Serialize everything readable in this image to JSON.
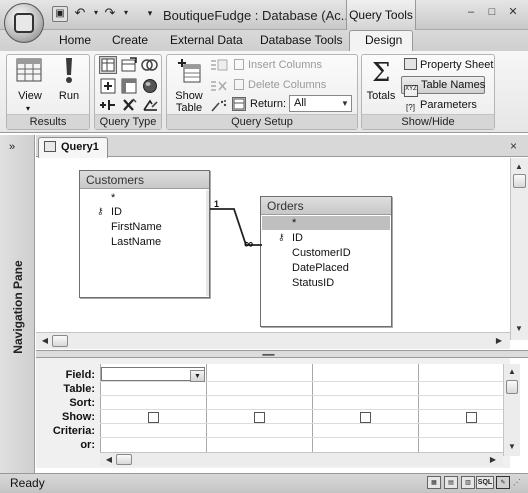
{
  "window": {
    "title": "BoutiqueFudge : Database (Ac...",
    "context_tab": "Query Tools",
    "controls": [
      "minimize",
      "maximize",
      "close"
    ]
  },
  "quick_access": {
    "icons": [
      "save-icon",
      "undo-icon",
      "redo-icon",
      "customize-icon"
    ]
  },
  "ribbon": {
    "tabs": [
      "Home",
      "Create",
      "External Data",
      "Database Tools",
      "Design"
    ],
    "active_tab": "Design",
    "groups": {
      "results": {
        "label": "Results",
        "view": "View",
        "run": "Run"
      },
      "query_type": {
        "label": "Query Type"
      },
      "query_setup": {
        "label": "Query Setup",
        "show_table_line1": "Show",
        "show_table_line2": "Table",
        "insert_columns": "Insert Columns",
        "delete_columns": "Delete Columns",
        "return_label": "Return:",
        "return_value": "All"
      },
      "show_hide": {
        "label": "Show/Hide",
        "totals": "Totals",
        "property_sheet": "Property Sheet",
        "table_names": "Table Names",
        "parameters": "Parameters"
      }
    }
  },
  "navigation_pane": {
    "label": "Navigation Pane",
    "toggle": "»"
  },
  "document": {
    "tab_label": "Query1",
    "close": "×"
  },
  "tables": {
    "customers": {
      "title": "Customers",
      "fields": [
        "*",
        "ID",
        "FirstName",
        "LastName"
      ],
      "key_field": "ID"
    },
    "orders": {
      "title": "Orders",
      "fields": [
        "*",
        "ID",
        "CustomerID",
        "DatePlaced",
        "StatusID"
      ],
      "key_field": "ID",
      "selected_field": "*"
    },
    "relationship": {
      "one_side": "1",
      "many_side": "∞"
    }
  },
  "design_grid": {
    "row_labels": [
      "Field:",
      "Table:",
      "Sort:",
      "Show:",
      "Criteria:",
      "or:"
    ],
    "columns": [
      {
        "field": "",
        "table": "",
        "sort": "",
        "show": false,
        "criteria": "",
        "or": ""
      },
      {
        "field": "",
        "table": "",
        "sort": "",
        "show": false,
        "criteria": "",
        "or": ""
      },
      {
        "field": "",
        "table": "",
        "sort": "",
        "show": false,
        "criteria": "",
        "or": ""
      },
      {
        "field": "",
        "table": "",
        "sort": "",
        "show": false,
        "criteria": "",
        "or": ""
      }
    ]
  },
  "status_bar": {
    "text": "Ready",
    "views": [
      "datasheet-view",
      "pivottable-view",
      "pivotchart-view",
      "sql-view",
      "design-view"
    ],
    "sql_label": "SQL"
  }
}
